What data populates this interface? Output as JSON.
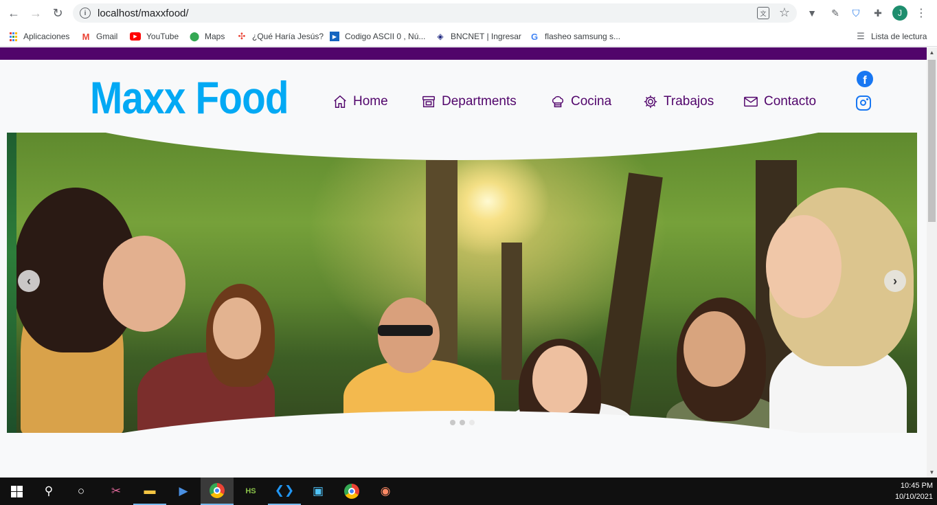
{
  "browser": {
    "url": "localhost/maxxfood/",
    "profile_initial": "J",
    "bookmarks": [
      {
        "label": "Aplicaciones",
        "icon": "apps-grid-icon"
      },
      {
        "label": "Gmail",
        "icon": "gmail-icon",
        "glyph": "M"
      },
      {
        "label": "YouTube",
        "icon": "youtube-icon",
        "glyph": "▶"
      },
      {
        "label": "Maps",
        "icon": "maps-pin-icon",
        "glyph": "⬤"
      },
      {
        "label": "¿Qué Haría Jesús?",
        "icon": "dots-icon",
        "glyph": "✣"
      },
      {
        "label": "Codigo ASCII 0 , Nú...",
        "icon": "ascii-icon",
        "glyph": "▶"
      },
      {
        "label": "BNCNET | Ingresar",
        "icon": "bncnet-icon",
        "glyph": "◈"
      },
      {
        "label": "flasheo samsung s...",
        "icon": "google-icon",
        "glyph": "G"
      }
    ],
    "reading_list_label": "Lista de lectura"
  },
  "site": {
    "logo": "Maxx Food",
    "accent_color": "#51056b",
    "logo_color": "#03a9f4",
    "nav": [
      {
        "label": "Home",
        "icon": "home-icon"
      },
      {
        "label": "Departments",
        "icon": "store-icon"
      },
      {
        "label": "Cocina",
        "icon": "chef-hat-icon"
      },
      {
        "label": "Trabajos",
        "icon": "gear-icon"
      },
      {
        "label": "Contacto",
        "icon": "envelope-icon"
      }
    ],
    "social": [
      {
        "name": "facebook",
        "icon": "facebook-icon",
        "glyph": "f"
      },
      {
        "name": "instagram",
        "icon": "instagram-icon"
      }
    ]
  },
  "carousel": {
    "prev_glyph": "‹",
    "next_glyph": "›",
    "slide_count": 3,
    "active_index": 2
  },
  "taskbar": {
    "time": "10:45 PM",
    "date": "10/10/2021"
  }
}
